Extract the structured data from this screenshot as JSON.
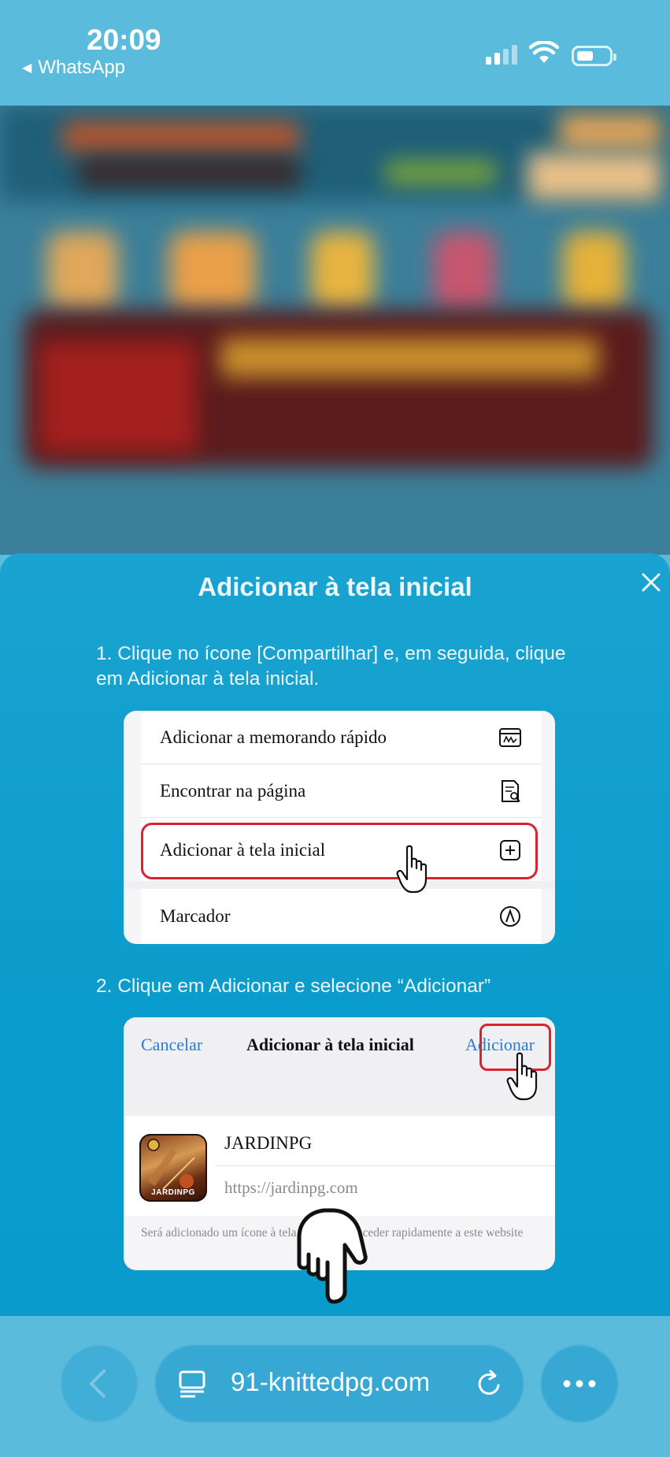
{
  "status_bar": {
    "time": "20:09",
    "back_app": "WhatsApp"
  },
  "sheet": {
    "title": "Adicionar à tela inicial",
    "step1": "1. Clique no ícone [Compartilhar] e, em seguida, clique em Adicionar à tela inicial.",
    "menu_items": [
      {
        "label": "Adicionar a memorando rápido",
        "icon": "quick-note-icon"
      },
      {
        "label": "Encontrar na página",
        "icon": "find-in-page-icon"
      },
      {
        "label": "Adicionar à tela inicial",
        "icon": "add-square-icon"
      },
      {
        "label": "Marcador",
        "icon": "markup-icon"
      }
    ],
    "step2": "2. Clique em Adicionar e selecione “Adicionar”",
    "dialog": {
      "cancel": "Cancelar",
      "title": "Adicionar à tela inicial",
      "add": "Adicionar",
      "app_name": "JARDINPG",
      "app_url": "https://jardinpg.com",
      "app_icon_label": "JARDINPG",
      "note": "Será adicionado um ícone à tela inicial para aceder rapidamente a este website"
    }
  },
  "bottom_bar": {
    "url": "91-knittedpg.com"
  },
  "colors": {
    "sheet_bg": "#0a9ccc",
    "highlight": "#d9232e",
    "link_blue": "#2a7bd3"
  }
}
